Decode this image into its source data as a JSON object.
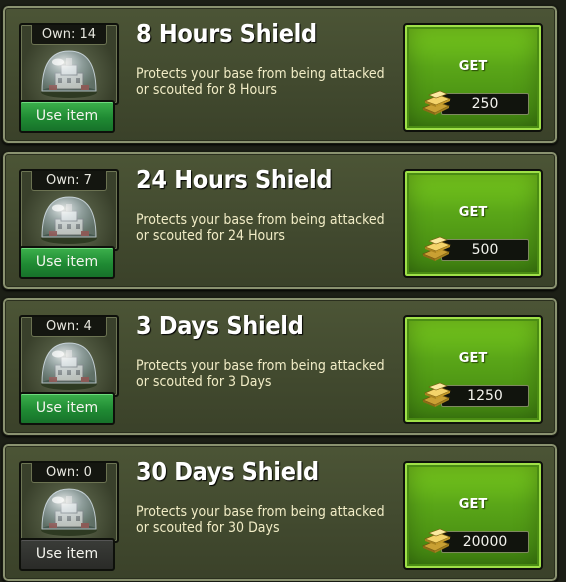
{
  "items": [
    {
      "title": "8 Hours Shield",
      "own_label": "Own: 14",
      "description": "Protects your base from being attacked or scouted for 8 Hours",
      "use_label": "Use item",
      "use_enabled": true,
      "get_label": "GET",
      "price": "250"
    },
    {
      "title": "24 Hours Shield",
      "own_label": "Own: 7",
      "description": "Protects your base from being attacked or scouted for 24 Hours",
      "use_label": "Use item",
      "use_enabled": true,
      "get_label": "GET",
      "price": "500"
    },
    {
      "title": "3 Days Shield",
      "own_label": "Own: 4",
      "description": "Protects your base from being attacked or scouted for 3 Days",
      "use_label": "Use item",
      "use_enabled": true,
      "get_label": "GET",
      "price": "1250"
    },
    {
      "title": "30 Days Shield",
      "own_label": "Own: 0",
      "description": "Protects your base from being attacked or scouted for 30 Days",
      "use_label": "Use item",
      "use_enabled": false,
      "get_label": "GET",
      "price": "20000"
    }
  ],
  "icons": {
    "item": "shield-dome-icon",
    "currency": "gold-bars-icon"
  },
  "colors": {
    "card_bg": "#465032",
    "get_green": "#5aa618",
    "use_green": "#1f8a33",
    "use_disabled": "#2a2b28",
    "desc_text": "#f1ecc6"
  }
}
